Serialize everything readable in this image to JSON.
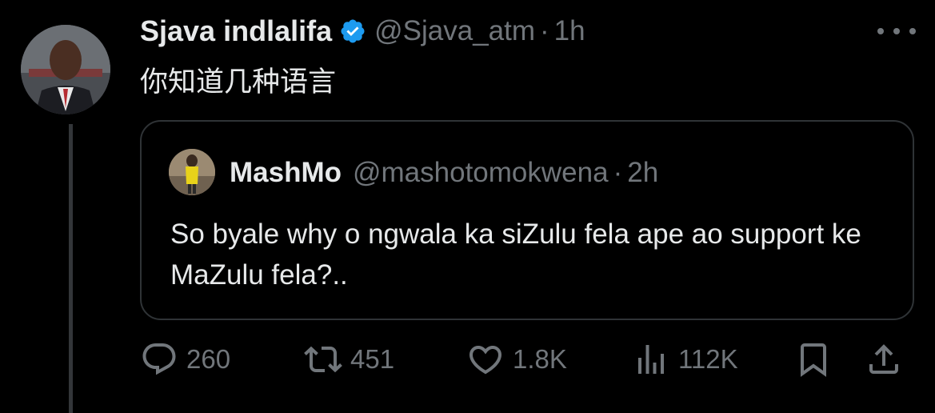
{
  "tweet": {
    "author_name": "Sjava indlalifa",
    "author_handle": "@Sjava_atm",
    "separator": "·",
    "time": "1h",
    "text": "你知道几种语言",
    "verified": true
  },
  "quoted_tweet": {
    "author_name": "MashMo",
    "author_handle": "@mashotomokwena",
    "separator": "·",
    "time": "2h",
    "text": "So byale why o ngwala ka siZulu fela ape ao support ke MaZulu fela?.."
  },
  "actions": {
    "replies": "260",
    "reposts": "451",
    "likes": "1.8K",
    "views": "112K"
  },
  "icons": {
    "verified": "verified-badge-icon",
    "more": "more-dots-icon",
    "reply": "reply-bubble-icon",
    "repost": "repost-arrows-icon",
    "like": "heart-icon",
    "views": "views-bar-chart-icon",
    "bookmark": "bookmark-icon",
    "share": "share-upload-icon"
  },
  "colors": {
    "background": "#000000",
    "text": "#e7e9ea",
    "secondary": "#71767b",
    "border": "#2f3336",
    "verified": "#1d9bf0"
  }
}
